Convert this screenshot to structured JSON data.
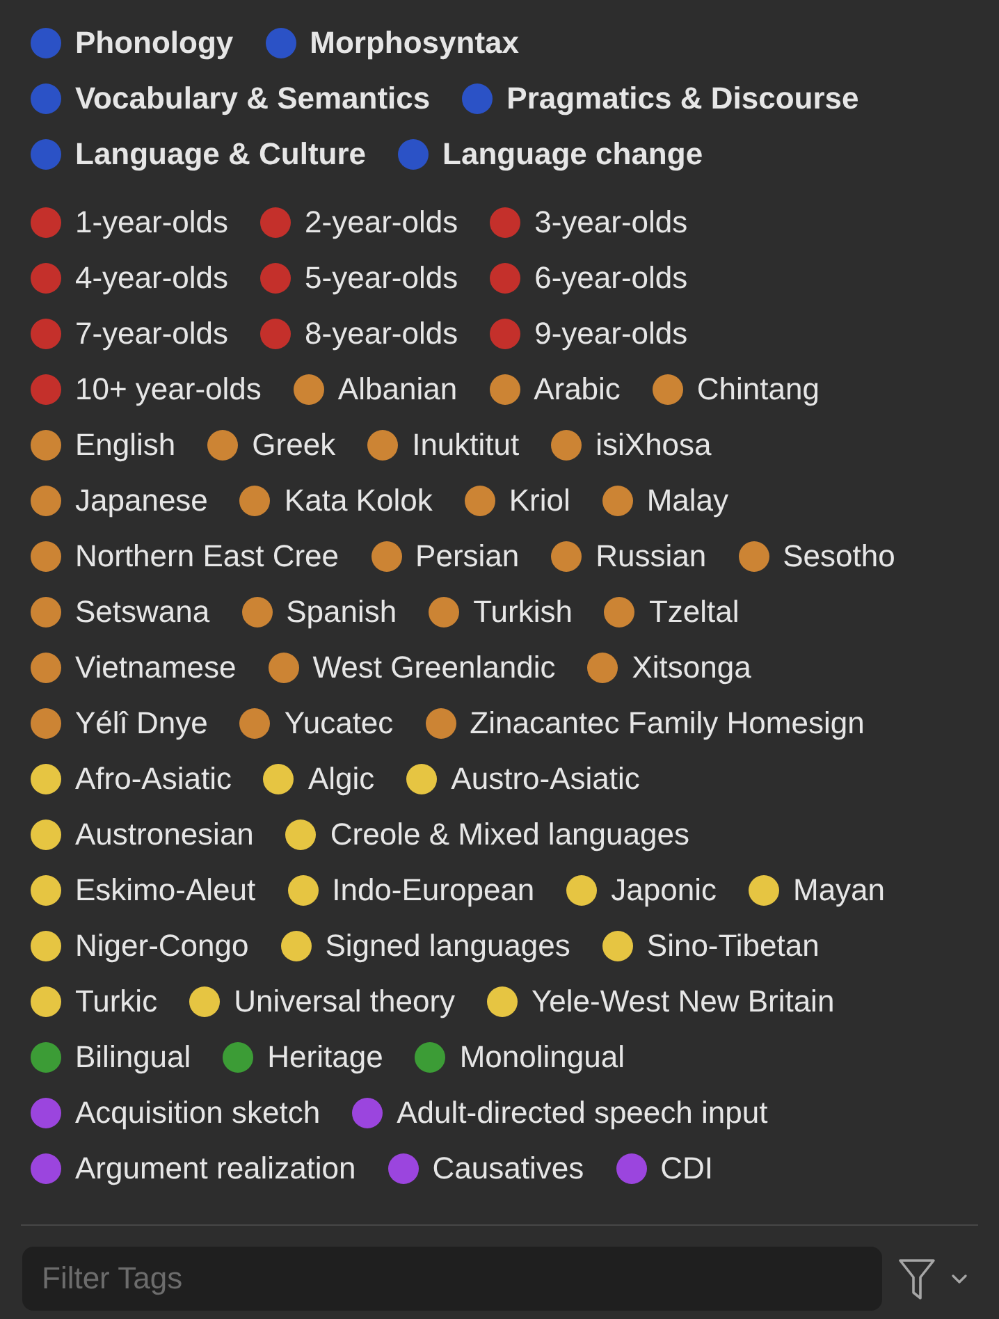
{
  "tag_groups": [
    {
      "kind": "primary",
      "rows": [
        [
          {
            "label": "Phonology",
            "color": "#2b52c6"
          },
          {
            "label": "Morphosyntax",
            "color": "#2b52c6"
          }
        ],
        [
          {
            "label": "Vocabulary & Semantics",
            "color": "#2b52c6"
          },
          {
            "label": "Pragmatics & Discourse",
            "color": "#2b52c6"
          }
        ],
        [
          {
            "label": "Language & Culture",
            "color": "#2b52c6"
          },
          {
            "label": "Language change",
            "color": "#2b52c6"
          }
        ]
      ]
    },
    {
      "kind": "secondary",
      "rows": [
        [
          {
            "label": "1-year-olds",
            "color": "#c4302b"
          },
          {
            "label": "2-year-olds",
            "color": "#c4302b"
          },
          {
            "label": "3-year-olds",
            "color": "#c4302b"
          }
        ],
        [
          {
            "label": "4-year-olds",
            "color": "#c4302b"
          },
          {
            "label": "5-year-olds",
            "color": "#c4302b"
          },
          {
            "label": "6-year-olds",
            "color": "#c4302b"
          }
        ],
        [
          {
            "label": "7-year-olds",
            "color": "#c4302b"
          },
          {
            "label": "8-year-olds",
            "color": "#c4302b"
          },
          {
            "label": "9-year-olds",
            "color": "#c4302b"
          }
        ],
        [
          {
            "label": "10+ year-olds",
            "color": "#c4302b"
          },
          {
            "label": "Albanian",
            "color": "#cc8434"
          },
          {
            "label": "Arabic",
            "color": "#cc8434"
          },
          {
            "label": "Chintang",
            "color": "#cc8434"
          }
        ],
        [
          {
            "label": "English",
            "color": "#cc8434"
          },
          {
            "label": "Greek",
            "color": "#cc8434"
          },
          {
            "label": "Inuktitut",
            "color": "#cc8434"
          },
          {
            "label": "isiXhosa",
            "color": "#cc8434"
          }
        ],
        [
          {
            "label": "Japanese",
            "color": "#cc8434"
          },
          {
            "label": "Kata Kolok",
            "color": "#cc8434"
          },
          {
            "label": "Kriol",
            "color": "#cc8434"
          },
          {
            "label": "Malay",
            "color": "#cc8434"
          }
        ],
        [
          {
            "label": "Northern East Cree",
            "color": "#cc8434"
          },
          {
            "label": "Persian",
            "color": "#cc8434"
          },
          {
            "label": "Russian",
            "color": "#cc8434"
          },
          {
            "label": "Sesotho",
            "color": "#cc8434"
          }
        ],
        [
          {
            "label": "Setswana",
            "color": "#cc8434"
          },
          {
            "label": "Spanish",
            "color": "#cc8434"
          },
          {
            "label": "Turkish",
            "color": "#cc8434"
          },
          {
            "label": "Tzeltal",
            "color": "#cc8434"
          }
        ],
        [
          {
            "label": "Vietnamese",
            "color": "#cc8434"
          },
          {
            "label": "West Greenlandic",
            "color": "#cc8434"
          },
          {
            "label": "Xitsonga",
            "color": "#cc8434"
          }
        ],
        [
          {
            "label": "Yélî Dnye",
            "color": "#cc8434"
          },
          {
            "label": "Yucatec",
            "color": "#cc8434"
          },
          {
            "label": "Zinacantec Family Homesign",
            "color": "#cc8434"
          }
        ],
        [
          {
            "label": "Afro-Asiatic",
            "color": "#e6c542"
          },
          {
            "label": "Algic",
            "color": "#e6c542"
          },
          {
            "label": "Austro-Asiatic",
            "color": "#e6c542"
          }
        ],
        [
          {
            "label": "Austronesian",
            "color": "#e6c542"
          },
          {
            "label": "Creole & Mixed languages",
            "color": "#e6c542"
          }
        ],
        [
          {
            "label": "Eskimo-Aleut",
            "color": "#e6c542"
          },
          {
            "label": "Indo-European",
            "color": "#e6c542"
          },
          {
            "label": "Japonic",
            "color": "#e6c542"
          },
          {
            "label": "Mayan",
            "color": "#e6c542"
          }
        ],
        [
          {
            "label": "Niger-Congo",
            "color": "#e6c542"
          },
          {
            "label": "Signed languages",
            "color": "#e6c542"
          },
          {
            "label": "Sino-Tibetan",
            "color": "#e6c542"
          }
        ],
        [
          {
            "label": "Turkic",
            "color": "#e6c542"
          },
          {
            "label": "Universal theory",
            "color": "#e6c542"
          },
          {
            "label": "Yele-West New Britain",
            "color": "#e6c542"
          }
        ],
        [
          {
            "label": "Bilingual",
            "color": "#3c9c36"
          },
          {
            "label": "Heritage",
            "color": "#3c9c36"
          },
          {
            "label": "Monolingual",
            "color": "#3c9c36"
          }
        ],
        [
          {
            "label": "Acquisition sketch",
            "color": "#9b45de"
          },
          {
            "label": "Adult-directed speech input",
            "color": "#9b45de"
          }
        ],
        [
          {
            "label": "Argument realization",
            "color": "#9b45de"
          },
          {
            "label": "Causatives",
            "color": "#9b45de"
          },
          {
            "label": "CDI",
            "color": "#9b45de"
          }
        ]
      ]
    }
  ],
  "filter_field": {
    "placeholder": "Filter Tags"
  }
}
